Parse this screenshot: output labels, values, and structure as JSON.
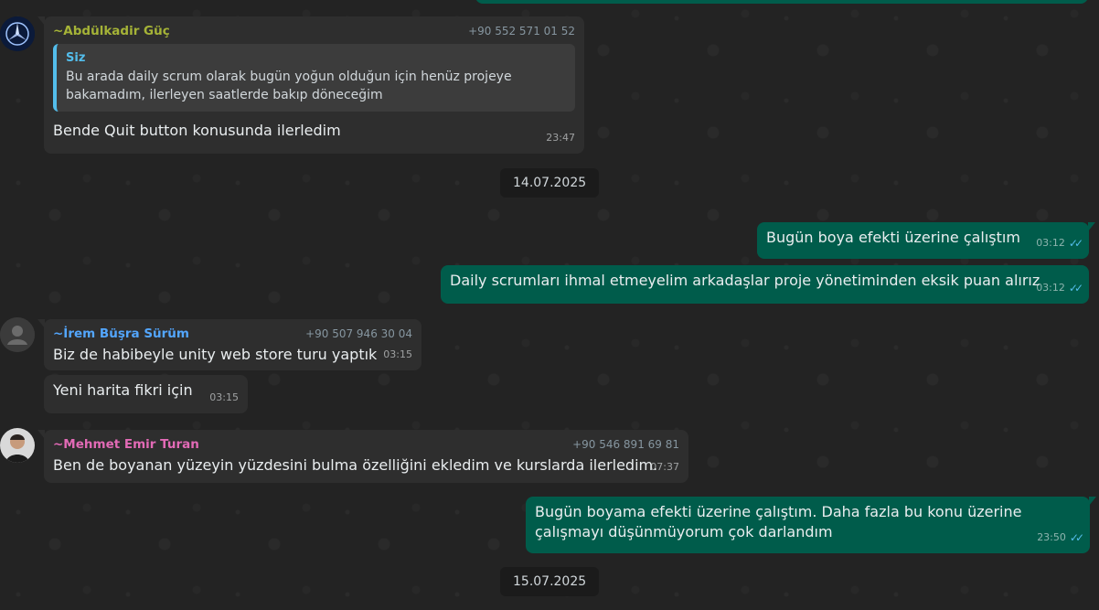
{
  "messages": [
    {
      "sender": "~Abdülkadir Güç",
      "phone": "+90 552 571 01 52",
      "quote_author": "Siz",
      "quote_text": "Bu arada daily scrum olarak bugün yoğun olduğun için henüz projeye bakamadım, ilerleyen saatlerde bakıp döneceğim",
      "text": "Bende Quit button konusunda ilerledim",
      "time": "23:47"
    },
    {
      "date": "14.07.2025"
    },
    {
      "text": "Bugün boya efekti üzerine çalıştım",
      "time": "03:12",
      "status": "read"
    },
    {
      "text": "Daily scrumları ihmal etmeyelim arkadaşlar proje yönetiminden eksik puan alırız",
      "time": "03:12",
      "status": "read"
    },
    {
      "sender": "~İrem Büşra Sürüm",
      "phone": "+90 507 946 30 04",
      "text": "Biz de habibeyle unity web store turu yaptık",
      "time": "03:15"
    },
    {
      "text": "Yeni harita fikri için",
      "time": "03:15"
    },
    {
      "sender": "~Mehmet Emir Turan",
      "phone": "+90 546 891 69 81",
      "text": "Ben de boyanan yüzeyin yüzdesini bulma özelliğini ekledim ve kurslarda ilerledim.",
      "time": "07:37"
    },
    {
      "text": "Bugün boyama efekti üzerine çalıştım. Daha fazla bu konu üzerine çalışmayı düşünmüyorum çok darlandım",
      "time": "23:50",
      "status": "read"
    },
    {
      "date": "15.07.2025"
    }
  ],
  "colors": {
    "sender_abdulkadir": "#a5b337",
    "sender_irem": "#53a6fd",
    "sender_mehmet": "#e26ab6",
    "outgoing_bubble": "#005c4b",
    "incoming_bubble": "#2e2e2e",
    "read_ticks": "#53bdeb"
  }
}
